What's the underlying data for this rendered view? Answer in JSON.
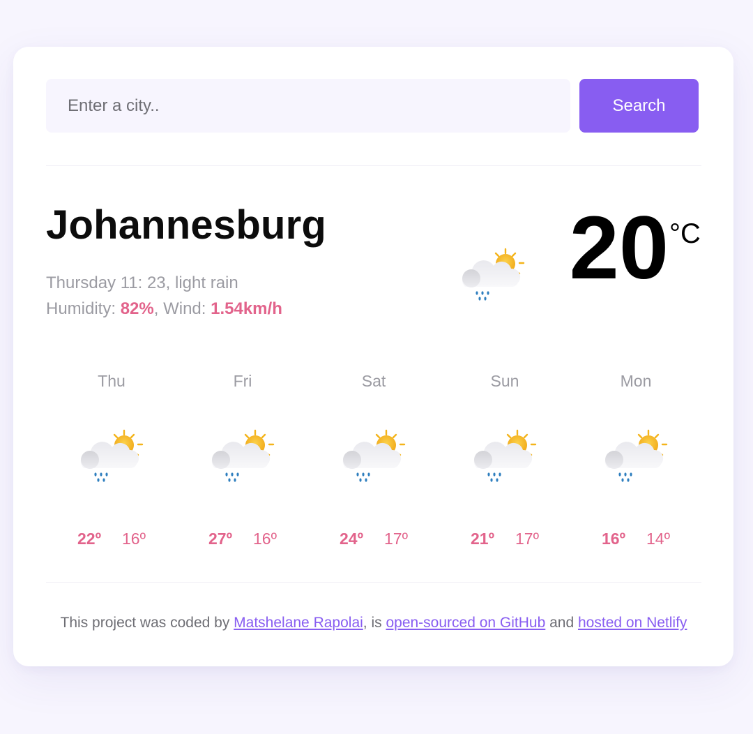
{
  "search": {
    "placeholder": "Enter a city..",
    "button_label": "Search"
  },
  "current": {
    "city": "Johannesburg",
    "day_time": "Thursday 11: 23",
    "description": "light rain",
    "humidity_label": "Humidity:",
    "humidity_value": "82%",
    "wind_label": "Wind:",
    "wind_value": "1.54km/h",
    "temperature": "20",
    "unit": "°C",
    "icon": "rain-partly-sunny-icon"
  },
  "forecast": [
    {
      "day": "Thu",
      "max": "22º",
      "min": "16º",
      "icon": "rain-partly-sunny-icon"
    },
    {
      "day": "Fri",
      "max": "27º",
      "min": "16º",
      "icon": "rain-partly-sunny-icon"
    },
    {
      "day": "Sat",
      "max": "24º",
      "min": "17º",
      "icon": "rain-partly-sunny-icon"
    },
    {
      "day": "Sun",
      "max": "21º",
      "min": "17º",
      "icon": "rain-partly-sunny-icon"
    },
    {
      "day": "Mon",
      "max": "16º",
      "min": "14º",
      "icon": "rain-partly-sunny-icon"
    }
  ],
  "footer": {
    "prefix": "This project was coded by ",
    "author_link": "Matshelane Rapolai",
    "middle": ", is ",
    "github_link": "open-sourced on GitHub",
    "connector": " and ",
    "netlify_link": "hosted on Netlify"
  },
  "colors": {
    "accent": "#885df1",
    "highlight": "#e2638b",
    "muted_text": "#9b9ba2",
    "background": "#f7f5fe"
  }
}
